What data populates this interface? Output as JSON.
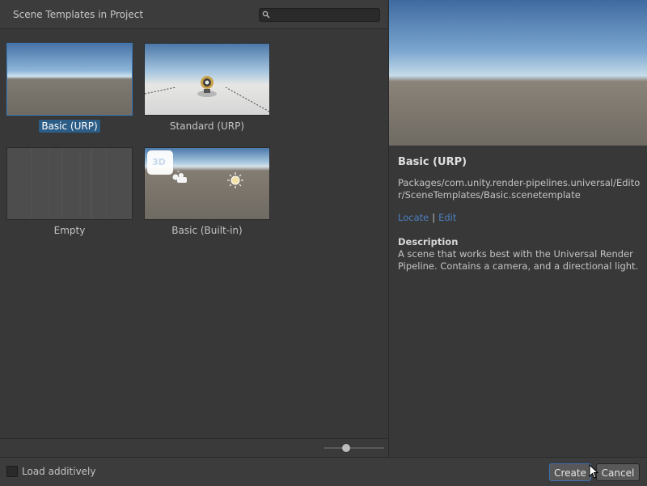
{
  "left_panel": {
    "title": "Scene Templates in Project",
    "search": {
      "value": "",
      "placeholder": ""
    }
  },
  "templates": [
    {
      "label": "Basic (URP)",
      "selected": true
    },
    {
      "label": "Standard (URP)",
      "selected": false
    },
    {
      "label": "Empty",
      "selected": false
    },
    {
      "label": "Basic (Built-in)",
      "selected": false
    }
  ],
  "thumbnail_badge": "3D",
  "zoom_slider": {
    "value": 0.35
  },
  "details": {
    "title": "Basic (URP)",
    "path": "Packages/com.unity.render-pipelines.universal/Editor/SceneTemplates/Basic.scenetemplate",
    "locate_label": "Locate",
    "separator": "|",
    "edit_label": "Edit",
    "description_heading": "Description",
    "description": "A scene that works best with the Universal Render Pipeline. Contains a camera, and a directional light."
  },
  "bottom_bar": {
    "load_additively_label": "Load additively",
    "load_additively_checked": false,
    "create_label": "Create",
    "cancel_label": "Cancel"
  },
  "colors": {
    "background": "#383838",
    "selection": "#2c5d87",
    "link": "#4c7fc0"
  }
}
